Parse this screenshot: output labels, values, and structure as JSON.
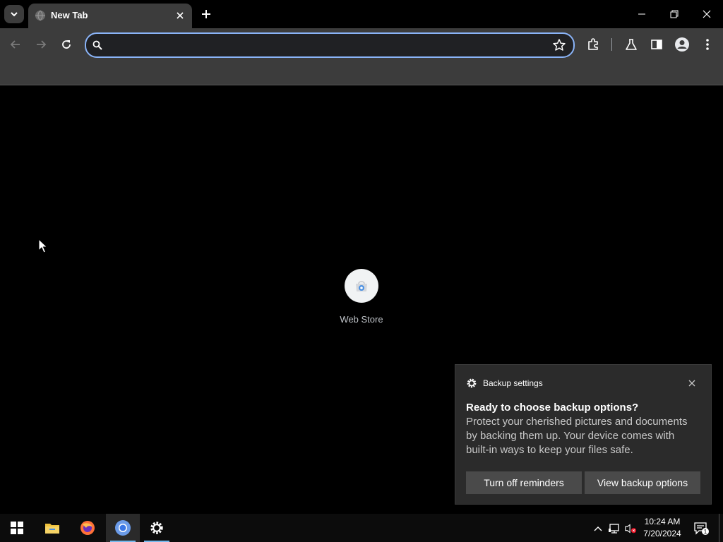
{
  "browser": {
    "tab": {
      "title": "New Tab"
    },
    "omnibox": {
      "value": "",
      "placeholder": ""
    }
  },
  "new_tab_page": {
    "shortcuts": [
      {
        "label": "Web Store"
      }
    ]
  },
  "notification": {
    "app_name": "Backup settings",
    "title": "Ready to choose backup options?",
    "body": "Protect your cherished pictures and documents by backing them up. Your device comes with built-in ways to keep your files safe.",
    "buttons": [
      "Turn off reminders",
      "View backup options"
    ]
  },
  "taskbar": {
    "apps": [
      "start-icon",
      "file-explorer-icon",
      "firefox-icon",
      "chrome-icon",
      "settings-icon"
    ],
    "clock": {
      "time": "10:24 AM",
      "date": "7/20/2024"
    },
    "action_center_badge": "1"
  },
  "colors": {
    "accent": "#8ab4f8",
    "toolbar": "#3c3c3c",
    "page_bg": "#000000",
    "taskbar": "#0c0c0c",
    "taskbar_active_underline": "#76b9ed"
  }
}
